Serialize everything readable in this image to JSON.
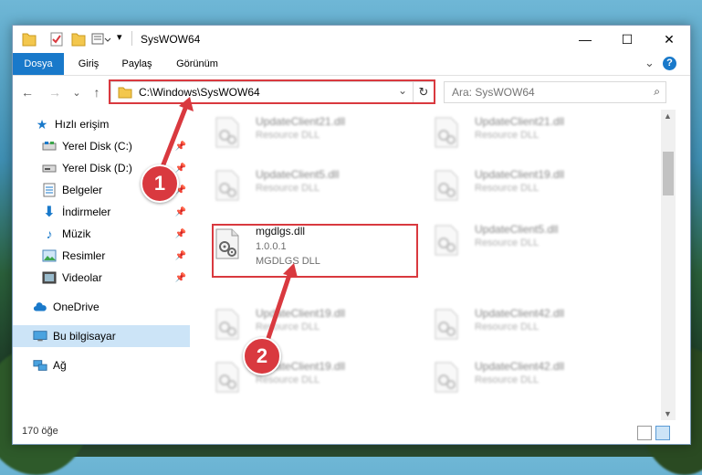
{
  "window": {
    "title": "SysWOW64",
    "minimize": "—",
    "maximize": "☐",
    "close": "✕"
  },
  "ribbon": {
    "tabs": [
      "Dosya",
      "Giriş",
      "Paylaş",
      "Görünüm"
    ],
    "collapse": "⌄",
    "help": "?"
  },
  "address": {
    "path": "C:\\Windows\\SysWOW64",
    "dropdown": "⌄",
    "refresh": "↻",
    "back": "←",
    "forward": "→",
    "recent": "⌄",
    "up": "↑"
  },
  "search": {
    "placeholder": "Ara: SysWOW64",
    "icon": "⌕"
  },
  "nav": {
    "items": [
      {
        "label": "Hızlı erişim",
        "icon": "star-icon"
      },
      {
        "label": "Yerel Disk (C:)",
        "icon": "drive-icon",
        "pinned": true
      },
      {
        "label": "Yerel Disk (D:)",
        "icon": "drive-icon",
        "pinned": true
      },
      {
        "label": "Belgeler",
        "icon": "documents-icon",
        "pinned": true
      },
      {
        "label": "İndirmeler",
        "icon": "download-icon",
        "pinned": true
      },
      {
        "label": "Müzik",
        "icon": "music-icon",
        "pinned": true
      },
      {
        "label": "Resimler",
        "icon": "pictures-icon",
        "pinned": true
      },
      {
        "label": "Videolar",
        "icon": "videos-icon",
        "pinned": true
      },
      {
        "label": "OneDrive",
        "icon": "cloud-icon"
      },
      {
        "label": "Bu bilgisayar",
        "icon": "computer-icon",
        "selected": true
      },
      {
        "label": "Ağ",
        "icon": "network-icon"
      }
    ],
    "pin_glyph": "📌"
  },
  "files": {
    "left": [
      {
        "name": "UpdateClient21.dll",
        "desc": "Resource DLL"
      },
      {
        "name": "UpdateClient5.dll",
        "desc": "Resource DLL"
      },
      {
        "name": "mgdlgs.dll",
        "version": "1.0.0.1",
        "desc": "MGDLGS DLL",
        "highlight": true
      },
      {
        "name": "UpdateClient19.dll",
        "desc": "Resource DLL"
      },
      {
        "name": "UpdateClient19.dll",
        "desc": "Resource DLL"
      }
    ],
    "right": [
      {
        "name": "UpdateClient21.dll",
        "desc": "Resource DLL"
      },
      {
        "name": "UpdateClient19.dll",
        "desc": "Resource DLL"
      },
      {
        "name": "UpdateClient5.dll",
        "desc": "Resource DLL"
      },
      {
        "name": "UpdateClient42.dll",
        "desc": "Resource DLL"
      },
      {
        "name": "UpdateClient42.dll",
        "desc": "Resource DLL"
      }
    ]
  },
  "status": {
    "count": "170 öğe"
  },
  "callouts": [
    "1",
    "2"
  ],
  "colors": {
    "accent": "#1979ca",
    "highlight": "#d9393f",
    "selected": "#cce4f7"
  }
}
